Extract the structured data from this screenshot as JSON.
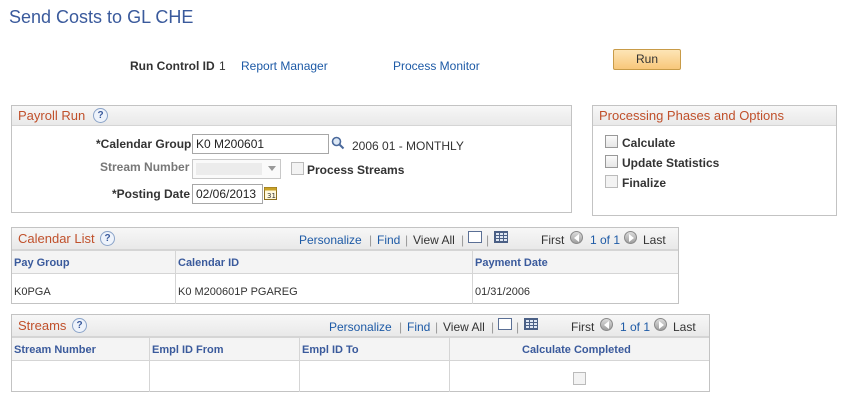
{
  "page": {
    "title": "Send Costs to GL CHE"
  },
  "toolbar": {
    "run_control_label": "Run Control ID",
    "run_control_value": "1",
    "report_manager": "Report Manager",
    "process_monitor": "Process Monitor",
    "run_label": "Run"
  },
  "payroll_run": {
    "title": "Payroll Run",
    "calendar_group_label": "*Calendar Group",
    "calendar_group_value": "K0 M200601",
    "calendar_group_desc": "2006 01 - MONTHLY",
    "stream_number_label": "Stream Number",
    "process_streams_label": "Process Streams",
    "posting_date_label": "*Posting Date",
    "posting_date_value": "02/06/2013"
  },
  "phases": {
    "title": "Processing Phases and Options",
    "options": [
      {
        "label": "Calculate",
        "enabled": true
      },
      {
        "label": "Update Statistics",
        "enabled": true
      },
      {
        "label": "Finalize",
        "enabled": false
      }
    ]
  },
  "calendar_list": {
    "title": "Calendar List",
    "personalize": "Personalize",
    "find": "Find",
    "view_all": "View All",
    "first": "First",
    "range": "1 of 1",
    "last": "Last",
    "columns": [
      "Pay Group",
      "Calendar ID",
      "Payment Date"
    ],
    "rows": [
      [
        "K0PGA",
        "K0 M200601P PGAREG",
        "01/31/2006"
      ]
    ]
  },
  "streams": {
    "title": "Streams",
    "personalize": "Personalize",
    "find": "Find",
    "view_all": "View All",
    "first": "First",
    "range": "1 of 1",
    "last": "Last",
    "columns": [
      "Stream Number",
      "Empl ID From",
      "Empl ID To",
      "Calculate Completed"
    ]
  },
  "colors": {
    "title_blue": "#3a5a9c",
    "link_blue": "#1d5aa6",
    "panel_title": "#c0502b",
    "run_button": "#f8c77a"
  }
}
